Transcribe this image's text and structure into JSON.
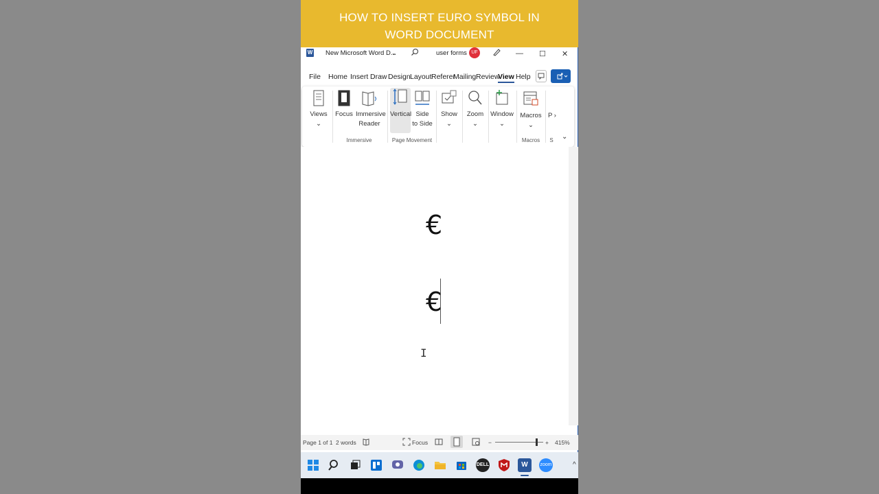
{
  "banner": {
    "line1": "HOW TO INSERT EURO SYMBOL IN",
    "line2": "WORD DOCUMENT"
  },
  "titlebar": {
    "app_icon": "W",
    "doc_title": "New Microsoft Word D...",
    "user_label": "user forms",
    "avatar_initials": "UF"
  },
  "menubar": {
    "tabs": [
      "File",
      "Home",
      "Insert",
      "Draw",
      "Design",
      "Layout",
      "Referer",
      "Mailing",
      "Review",
      "View",
      "Help"
    ],
    "active": "View"
  },
  "ribbon": {
    "views": "Views",
    "focus": "Focus",
    "immersive_reader_1": "Immersive",
    "immersive_reader_2": "Reader",
    "vertical": "Vertical",
    "side_to_side_1": "Side",
    "side_to_side_2": "to Side",
    "show": "Show",
    "zoom": "Zoom",
    "window": "Window",
    "macros": "Macros",
    "more": "P",
    "group_immersive": "Immersive",
    "group_page_movement": "Page Movement",
    "group_macros": "Macros",
    "group_more": "S"
  },
  "document": {
    "line1": "€",
    "line2": "€"
  },
  "status": {
    "page": "Page 1 of 1",
    "words": "2 words",
    "focus": "Focus",
    "zoom": "415%",
    "minus": "−",
    "plus": "+"
  },
  "taskbar": {
    "dell": "DELL",
    "zoom": "zoom"
  },
  "colors": {
    "banner": "#e8b92e",
    "word_blue": "#2b579a",
    "avatar_red": "#e0303b"
  }
}
